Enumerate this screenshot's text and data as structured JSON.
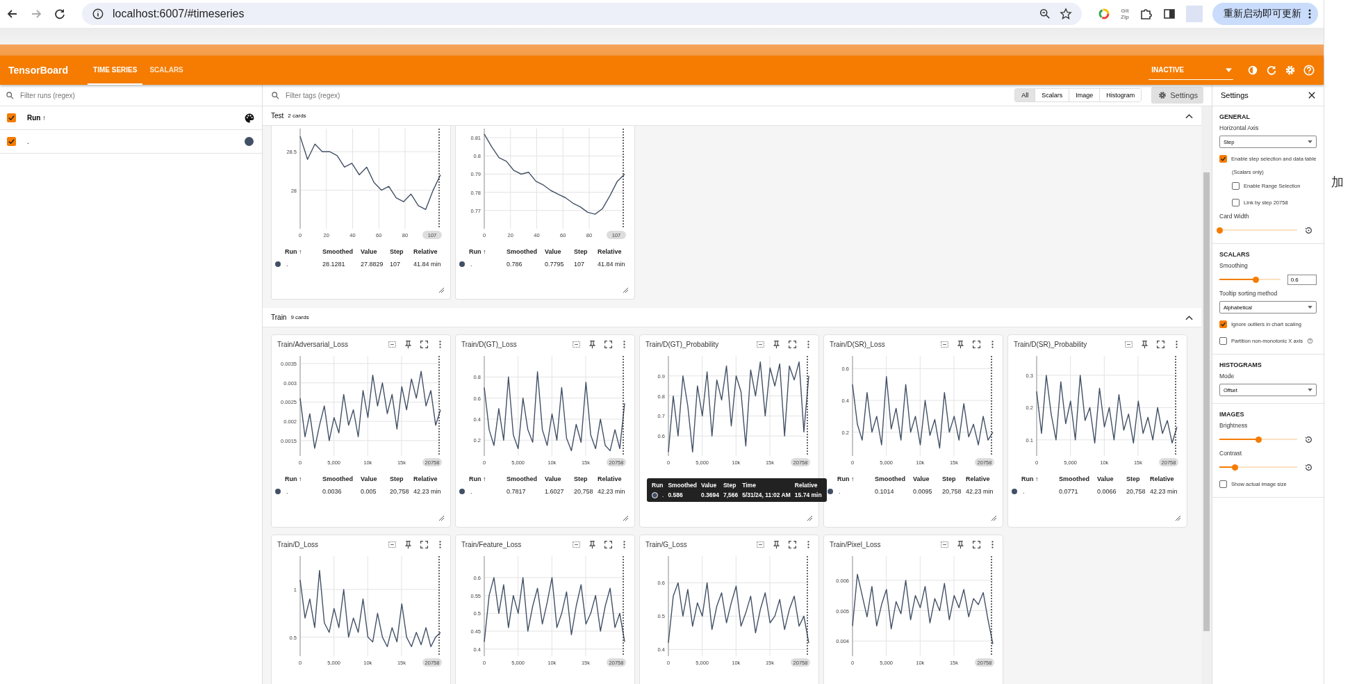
{
  "browser": {
    "url": "localhost:6007/#timeseries",
    "update_button": "重新启动即可更新",
    "extension_label_1": "Git",
    "extension_label_2": "Zip"
  },
  "header": {
    "title": "TensorBoard",
    "tabs": [
      {
        "label": "TIME SERIES",
        "selected": true
      },
      {
        "label": "SCALARS",
        "selected": false
      }
    ],
    "status": "INACTIVE"
  },
  "runs_panel": {
    "placeholder": "Filter runs (regex)",
    "header": {
      "label": "Run ↑",
      "checked": true
    },
    "runs": [
      {
        "label": ".",
        "checked": true,
        "color": "#425066"
      }
    ]
  },
  "toolbar": {
    "placeholder": "Filter tags (regex)",
    "filters": [
      {
        "label": "All",
        "selected": true
      },
      {
        "label": "Scalars",
        "selected": false
      },
      {
        "label": "Image",
        "selected": false
      },
      {
        "label": "Histogram",
        "selected": false
      }
    ],
    "settings_button": "Settings"
  },
  "groups": [
    {
      "name": "Test",
      "count": "2 cards",
      "cards": [
        {
          "step_chip": "107",
          "legend": {
            "columns": [
              "Run ↑",
              "Smoothed",
              "Value",
              "Step",
              "Relative"
            ],
            "smoothed": "28.1281",
            "value": "27.8829",
            "step": "107",
            "relative": "41.84 min"
          },
          "chart_data": {
            "type": "line",
            "grid": true,
            "x": [
              0,
              5.6,
              11.3,
              16.9,
              22.5,
              28.2,
              33.8,
              39.4,
              45.1,
              50.7,
              56.3,
              61.9,
              67.6,
              73.2,
              78.8,
              84.5,
              90.1,
              95.7,
              101.4,
              107
            ],
            "xlim": [
              0,
              107
            ],
            "ylim": [
              27.5,
              28.8
            ],
            "xticks": [
              0,
              20,
              40,
              60,
              80
            ],
            "yticks": [
              28,
              28.5
            ],
            "series": [
              {
                "name": ".",
                "color": "#425066",
                "values": [
                  28.7,
                  28.4,
                  28.6,
                  28.5,
                  28.5,
                  28.45,
                  28.3,
                  28.35,
                  28.2,
                  28.3,
                  28.1,
                  28.0,
                  28.05,
                  27.9,
                  27.85,
                  27.95,
                  27.8,
                  27.75,
                  28.0,
                  28.2
                ]
              }
            ]
          }
        },
        {
          "step_chip": "107",
          "legend": {
            "columns": [
              "Run ↑",
              "Smoothed",
              "Value",
              "Step",
              "Relative"
            ],
            "smoothed": "0.786",
            "value": "0.7795",
            "step": "107",
            "relative": "41.84 min"
          },
          "chart_data": {
            "type": "line",
            "grid": true,
            "x": [
              0,
              5.6,
              11.3,
              16.9,
              22.5,
              28.2,
              33.8,
              39.4,
              45.1,
              50.7,
              56.3,
              61.9,
              67.6,
              73.2,
              78.8,
              84.5,
              90.1,
              95.7,
              101.4,
              107
            ],
            "xlim": [
              0,
              107
            ],
            "ylim": [
              0.76,
              0.815
            ],
            "xticks": [
              0,
              20,
              40,
              60,
              80
            ],
            "yticks": [
              0.77,
              0.78,
              0.79,
              0.8,
              0.81
            ],
            "series": [
              {
                "name": ".",
                "color": "#425066",
                "values": [
                  0.812,
                  0.805,
                  0.799,
                  0.797,
                  0.792,
                  0.79,
                  0.791,
                  0.786,
                  0.784,
                  0.781,
                  0.779,
                  0.777,
                  0.774,
                  0.772,
                  0.769,
                  0.768,
                  0.771,
                  0.778,
                  0.786,
                  0.79
                ]
              }
            ]
          }
        }
      ]
    },
    {
      "name": "Train",
      "count": "9 cards",
      "cards": [
        {
          "title": "Train/Adversarial_Loss",
          "step_chip": "20758",
          "legend": {
            "columns": [
              "Run ↑",
              "Smoothed",
              "Value",
              "Step",
              "Relative"
            ],
            "smoothed": "0.0036",
            "value": "0.005",
            "step": "20,758",
            "relative": "42.23 min"
          },
          "chart_data": {
            "type": "line",
            "grid": true,
            "x": [
              0,
              716,
              1432,
              2147,
              2863,
              3579,
              4295,
              5010,
              5726,
              6442,
              7158,
              7874,
              8589,
              9305,
              10021,
              10737,
              11452,
              12168,
              12884,
              13600,
              14316,
              15031,
              15747,
              16463,
              17179,
              17894,
              18610,
              19326,
              20042,
              20758
            ],
            "xlim": [
              0,
              20758
            ],
            "ylim": [
              0.0011,
              0.0037
            ],
            "xticks": [
              0,
              {
                "value": 5000,
                "label": "5,000"
              },
              {
                "value": 10000,
                "label": "10k"
              },
              {
                "value": 15000,
                "label": "15k"
              }
            ],
            "yticks": [
              0.0015,
              0.002,
              0.0025,
              0.003,
              0.0035
            ],
            "series": [
              {
                "name": ".",
                "color": "#425066",
                "values": [
                  0.0026,
                  0.0016,
                  0.0022,
                  0.0013,
                  0.0019,
                  0.0024,
                  0.0015,
                  0.0021,
                  0.0017,
                  0.0027,
                  0.0019,
                  0.0023,
                  0.0016,
                  0.0028,
                  0.0021,
                  0.0032,
                  0.0024,
                  0.003,
                  0.0022,
                  0.0027,
                  0.0018,
                  0.0029,
                  0.0023,
                  0.0031,
                  0.0026,
                  0.0033,
                  0.0024,
                  0.0028,
                  0.0019,
                  0.0023
                ]
              }
            ]
          }
        },
        {
          "title": "Train/D(GT)_Loss",
          "step_chip": "20758",
          "legend": {
            "columns": [
              "Run ↑",
              "Smoothed",
              "Value",
              "Step",
              "Relative"
            ],
            "smoothed": "0.7817",
            "value": "1.6027",
            "step": "20,758",
            "relative": "42.23 min"
          },
          "chart_data": {
            "type": "line",
            "grid": true,
            "x": [
              0,
              716,
              1432,
              2147,
              2863,
              3579,
              4295,
              5010,
              5726,
              6442,
              7158,
              7874,
              8589,
              9305,
              10021,
              10737,
              11452,
              12168,
              12884,
              13600,
              14316,
              15031,
              15747,
              16463,
              17179,
              17894,
              18610,
              19326,
              20042,
              20758
            ],
            "xlim": [
              0,
              20758
            ],
            "ylim": [
              0.05,
              1.0
            ],
            "xticks": [
              0,
              {
                "value": 5000,
                "label": "5,000"
              },
              {
                "value": 10000,
                "label": "10k"
              },
              {
                "value": 15000,
                "label": "15k"
              }
            ],
            "yticks": [
              0.2,
              0.4,
              0.6,
              0.8
            ],
            "series": [
              {
                "name": ".",
                "color": "#425066",
                "values": [
                  0.7,
                  0.3,
                  0.15,
                  0.5,
                  0.2,
                  0.8,
                  0.25,
                  0.12,
                  0.6,
                  0.3,
                  0.18,
                  0.85,
                  0.3,
                  0.15,
                  0.45,
                  0.2,
                  0.7,
                  0.22,
                  0.1,
                  0.35,
                  0.18,
                  0.75,
                  0.25,
                  0.12,
                  0.4,
                  0.15,
                  0.1,
                  0.3,
                  0.12,
                  0.55
                ]
              }
            ]
          }
        },
        {
          "title": "Train/D(GT)_Probability",
          "step_chip": "20758",
          "chart_data": {
            "type": "line",
            "grid": true,
            "x": [
              0,
              716,
              1432,
              2147,
              2863,
              3579,
              4295,
              5010,
              5726,
              6442,
              7158,
              7874,
              8589,
              9305,
              10021,
              10737,
              11452,
              12168,
              12884,
              13600,
              14316,
              15031,
              15747,
              16463,
              17179,
              17894,
              18610,
              19326,
              20042,
              20758
            ],
            "xlim": [
              0,
              20758
            ],
            "ylim": [
              0.5,
              1.0
            ],
            "xticks": [
              0,
              {
                "value": 5000,
                "label": "5,000"
              },
              {
                "value": 10000,
                "label": "10k"
              },
              {
                "value": 15000,
                "label": "15k"
              }
            ],
            "yticks": [
              0.6,
              0.7,
              0.8,
              0.9
            ],
            "series": [
              {
                "name": ".",
                "color": "#425066",
                "values": [
                  0.52,
                  0.8,
                  0.6,
                  0.9,
                  0.75,
                  0.52,
                  0.85,
                  0.7,
                  0.92,
                  0.6,
                  0.88,
                  0.78,
                  0.95,
                  0.65,
                  0.9,
                  0.82,
                  0.55,
                  0.93,
                  0.8,
                  0.97,
                  0.7,
                  0.94,
                  0.85,
                  0.96,
                  0.6,
                  0.95,
                  0.88,
                  0.97,
                  0.62,
                  0.9
                ]
              }
            ]
          },
          "tooltip": {
            "columns": [
              "Run",
              "Smoothed",
              "Value",
              "Step",
              "Time",
              "Relative"
            ],
            "values": [
              "0.586",
              "0.3694",
              "7,566",
              "5/31/24, 11:02 AM",
              "15.74 min"
            ]
          }
        },
        {
          "title": "Train/D(SR)_Loss",
          "step_chip": "20758",
          "legend": {
            "columns": [
              "Run ↑",
              "Smoothed",
              "Value",
              "Step",
              "Relative"
            ],
            "smoothed": "0.1014",
            "value": "0.0095",
            "step": "20,758",
            "relative": "42.23 min"
          },
          "chart_data": {
            "type": "line",
            "grid": true,
            "x": [
              0,
              716,
              1432,
              2147,
              2863,
              3579,
              4295,
              5010,
              5726,
              6442,
              7158,
              7874,
              8589,
              9305,
              10021,
              10737,
              11452,
              12168,
              12884,
              13600,
              14316,
              15031,
              15747,
              16463,
              17179,
              17894,
              18610,
              19326,
              20042,
              20758
            ],
            "xlim": [
              0,
              20758
            ],
            "ylim": [
              0.05,
              0.68
            ],
            "xticks": [
              0,
              {
                "value": 5000,
                "label": "5,000"
              },
              {
                "value": 10000,
                "label": "10k"
              },
              {
                "value": 15000,
                "label": "15k"
              }
            ],
            "yticks": [
              0.2,
              0.4,
              0.6
            ],
            "series": [
              {
                "name": ".",
                "color": "#425066",
                "values": [
                  0.5,
                  0.25,
                  0.15,
                  0.45,
                  0.2,
                  0.3,
                  0.12,
                  0.55,
                  0.22,
                  0.35,
                  0.15,
                  0.5,
                  0.2,
                  0.3,
                  0.12,
                  0.4,
                  0.18,
                  0.28,
                  0.1,
                  0.45,
                  0.2,
                  0.3,
                  0.15,
                  0.38,
                  0.17,
                  0.25,
                  0.12,
                  0.3,
                  0.15,
                  0.2
                ]
              }
            ]
          }
        },
        {
          "title": "Train/D(SR)_Probability",
          "step_chip": "20758",
          "legend": {
            "columns": [
              "Run ↑",
              "Smoothed",
              "Value",
              "Step",
              "Relative"
            ],
            "smoothed": "0.0771",
            "value": "0.0066",
            "step": "20,758",
            "relative": "42.23 min"
          },
          "chart_data": {
            "type": "line",
            "grid": true,
            "x": [
              0,
              716,
              1432,
              2147,
              2863,
              3579,
              4295,
              5010,
              5726,
              6442,
              7158,
              7874,
              8589,
              9305,
              10021,
              10737,
              11452,
              12168,
              12884,
              13600,
              14316,
              15031,
              15747,
              16463,
              17179,
              17894,
              18610,
              19326,
              20042,
              20758
            ],
            "xlim": [
              0,
              20758
            ],
            "ylim": [
              0.05,
              0.36
            ],
            "xticks": [
              0,
              {
                "value": 5000,
                "label": "5,000"
              },
              {
                "value": 10000,
                "label": "10k"
              },
              {
                "value": 15000,
                "label": "15k"
              }
            ],
            "yticks": [
              0.1,
              0.2,
              0.3
            ],
            "series": [
              {
                "name": ".",
                "color": "#425066",
                "values": [
                  0.25,
                  0.12,
                  0.3,
                  0.18,
                  0.1,
                  0.28,
                  0.15,
                  0.22,
                  0.1,
                  0.3,
                  0.16,
                  0.2,
                  0.09,
                  0.26,
                  0.14,
                  0.2,
                  0.1,
                  0.24,
                  0.13,
                  0.18,
                  0.09,
                  0.22,
                  0.12,
                  0.17,
                  0.1,
                  0.2,
                  0.12,
                  0.16,
                  0.09,
                  0.14
                ]
              }
            ]
          }
        },
        {
          "title": "Train/D_Loss",
          "step_chip": "20758",
          "chart_data": {
            "type": "line",
            "grid": true,
            "x": [
              0,
              716,
              1432,
              2147,
              2863,
              3579,
              4295,
              5010,
              5726,
              6442,
              7158,
              7874,
              8589,
              9305,
              10021,
              10737,
              11452,
              12168,
              12884,
              13600,
              14316,
              15031,
              15747,
              16463,
              17179,
              17894,
              18610,
              19326,
              20042,
              20758
            ],
            "xlim": [
              0,
              20758
            ],
            "ylim": [
              0.3,
              1.35
            ],
            "xticks": [
              0,
              {
                "value": 5000,
                "label": "5,000"
              },
              {
                "value": 10000,
                "label": "10k"
              },
              {
                "value": 15000,
                "label": "15k"
              }
            ],
            "yticks": [
              0.5,
              1
            ],
            "series": [
              {
                "color": "#425066",
                "values": [
                  1.1,
                  0.7,
                  0.9,
                  0.6,
                  1.2,
                  0.65,
                  0.55,
                  0.8,
                  0.6,
                  1.0,
                  0.5,
                  0.7,
                  0.55,
                  0.9,
                  0.5,
                  0.45,
                  0.75,
                  0.5,
                  0.4,
                  0.6,
                  0.45,
                  0.85,
                  0.5,
                  0.4,
                  0.55,
                  0.42,
                  0.6,
                  0.4,
                  0.5,
                  0.55
                ]
              }
            ]
          }
        },
        {
          "title": "Train/Feature_Loss",
          "step_chip": "20758",
          "chart_data": {
            "type": "line",
            "grid": true,
            "x": [
              0,
              716,
              1432,
              2147,
              2863,
              3579,
              4295,
              5010,
              5726,
              6442,
              7158,
              7874,
              8589,
              9305,
              10021,
              10737,
              11452,
              12168,
              12884,
              13600,
              14316,
              15031,
              15747,
              16463,
              17179,
              17894,
              18610,
              19326,
              20042,
              20758
            ],
            "xlim": [
              0,
              20758
            ],
            "ylim": [
              0.38,
              0.66
            ],
            "xticks": [
              0,
              {
                "value": 5000,
                "label": "5,000"
              },
              {
                "value": 10000,
                "label": "10k"
              },
              {
                "value": 15000,
                "label": "15k"
              }
            ],
            "yticks": [
              0.4,
              0.45,
              0.5,
              0.55,
              0.6
            ],
            "series": [
              {
                "color": "#425066",
                "values": [
                  0.42,
                  0.55,
                  0.6,
                  0.5,
                  0.58,
                  0.46,
                  0.55,
                  0.5,
                  0.6,
                  0.45,
                  0.52,
                  0.57,
                  0.47,
                  0.53,
                  0.6,
                  0.46,
                  0.5,
                  0.56,
                  0.44,
                  0.52,
                  0.58,
                  0.47,
                  0.5,
                  0.55,
                  0.45,
                  0.52,
                  0.57,
                  0.46,
                  0.5,
                  0.42
                ]
              }
            ]
          }
        },
        {
          "title": "Train/G_Loss",
          "step_chip": "20758",
          "chart_data": {
            "type": "line",
            "grid": true,
            "x": [
              0,
              716,
              1432,
              2147,
              2863,
              3579,
              4295,
              5010,
              5726,
              6442,
              7158,
              7874,
              8589,
              9305,
              10021,
              10737,
              11452,
              12168,
              12884,
              13600,
              14316,
              15031,
              15747,
              16463,
              17179,
              17894,
              18610,
              19326,
              20042,
              20758
            ],
            "xlim": [
              0,
              20758
            ],
            "ylim": [
              0.38,
              0.68
            ],
            "xticks": [
              0,
              {
                "value": 5000,
                "label": "5,000"
              },
              {
                "value": 10000,
                "label": "10k"
              },
              {
                "value": 15000,
                "label": "15k"
              }
            ],
            "yticks": [
              0.4,
              0.5,
              0.6
            ],
            "series": [
              {
                "color": "#425066",
                "values": [
                  0.42,
                  0.56,
                  0.6,
                  0.5,
                  0.58,
                  0.47,
                  0.54,
                  0.5,
                  0.6,
                  0.46,
                  0.53,
                  0.57,
                  0.48,
                  0.54,
                  0.59,
                  0.47,
                  0.51,
                  0.56,
                  0.45,
                  0.52,
                  0.57,
                  0.48,
                  0.5,
                  0.55,
                  0.46,
                  0.52,
                  0.56,
                  0.47,
                  0.5,
                  0.42
                ]
              }
            ]
          }
        },
        {
          "title": "Train/Pixel_Loss",
          "step_chip": "20758",
          "chart_data": {
            "type": "line",
            "grid": true,
            "x": [
              0,
              716,
              1432,
              2147,
              2863,
              3579,
              4295,
              5010,
              5726,
              6442,
              7158,
              7874,
              8589,
              9305,
              10021,
              10737,
              11452,
              12168,
              12884,
              13600,
              14316,
              15031,
              15747,
              16463,
              17179,
              17894,
              18610,
              19326,
              20042,
              20758
            ],
            "xlim": [
              0,
              20758
            ],
            "ylim": [
              0.0035,
              0.0068
            ],
            "xticks": [
              0,
              {
                "value": 5000,
                "label": "5,000"
              },
              {
                "value": 10000,
                "label": "10k"
              },
              {
                "value": 15000,
                "label": "15k"
              }
            ],
            "yticks": [
              0.004,
              0.005,
              0.006
            ],
            "series": [
              {
                "color": "#425066",
                "values": [
                  0.0045,
                  0.0062,
                  0.0055,
                  0.0048,
                  0.0058,
                  0.0045,
                  0.0052,
                  0.0057,
                  0.0044,
                  0.0053,
                  0.0049,
                  0.006,
                  0.0047,
                  0.0055,
                  0.0051,
                  0.0058,
                  0.0046,
                  0.0054,
                  0.005,
                  0.0059,
                  0.0047,
                  0.0055,
                  0.0051,
                  0.0057,
                  0.0048,
                  0.0054,
                  0.0052,
                  0.0056,
                  0.0047,
                  0.0039
                ]
              }
            ]
          }
        }
      ]
    }
  ],
  "settings": {
    "title": "Settings",
    "sections": [
      {
        "heading": "GENERAL",
        "items": [
          {
            "kind": "select",
            "label": "Horizontal Axis",
            "value": "Step"
          },
          {
            "kind": "checkbox",
            "label": "Enable step selection and data table",
            "checked": true
          },
          {
            "kind": "note",
            "label": "(Scalars only)"
          },
          {
            "kind": "subcheckbox",
            "label": "Enable Range Selection",
            "checked": false
          },
          {
            "kind": "subcheckbox",
            "label": "Link by step 20758",
            "checked": false
          },
          {
            "kind": "slider",
            "label": "Card Width",
            "level": 0.0,
            "reset": true
          }
        ]
      },
      {
        "heading": "SCALARS",
        "items": [
          {
            "kind": "slider",
            "label": "Smoothing",
            "level": 0.6,
            "value": "0.6"
          },
          {
            "kind": "select",
            "label": "Tooltip sorting method",
            "value": "Alphabetical"
          },
          {
            "kind": "checkbox",
            "label": "Ignore outliers in chart scaling",
            "checked": true
          },
          {
            "kind": "checkbox",
            "label": "Partition non-monotonic X axis",
            "checked": false,
            "help": true
          }
        ]
      },
      {
        "heading": "HISTOGRAMS",
        "items": [
          {
            "kind": "select",
            "label": "Mode",
            "value": "Offset"
          }
        ]
      },
      {
        "heading": "IMAGES",
        "items": [
          {
            "kind": "slider",
            "label": "Brightness",
            "level": 0.5,
            "reset": true
          },
          {
            "kind": "slider",
            "label": "Contrast",
            "level": 0.2,
            "reset": true
          },
          {
            "kind": "checkbox",
            "label": "Show actual image size",
            "checked": false
          }
        ]
      }
    ]
  },
  "side_window": {
    "text": "加"
  }
}
